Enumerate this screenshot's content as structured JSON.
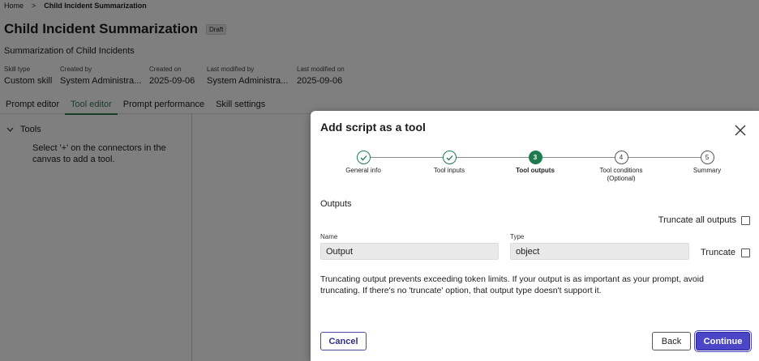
{
  "breadcrumb": {
    "home": "Home",
    "separator": ">",
    "current": "Child Incident Summarization"
  },
  "page": {
    "title": "Child Incident Summarization",
    "badge": "Draft",
    "subtitle": "Summarization of Child Incidents"
  },
  "meta": [
    {
      "key": "Skill type",
      "value": "Custom skill"
    },
    {
      "key": "Created by",
      "value": "System Administra..."
    },
    {
      "key": "Created on",
      "value": "2025-09-06"
    },
    {
      "key": "Last modified by",
      "value": "System Administra..."
    },
    {
      "key": "Last modified on",
      "value": "2025-09-06"
    }
  ],
  "tabs": [
    {
      "label": "Prompt editor",
      "active": false
    },
    {
      "label": "Tool editor",
      "active": true
    },
    {
      "label": "Prompt performance",
      "active": false
    },
    {
      "label": "Skill settings",
      "active": false
    }
  ],
  "tools": {
    "header": "Tools",
    "hint": "Select '+' on the connectors in the canvas to add a tool."
  },
  "modal": {
    "title": "Add script as a tool",
    "steps": [
      {
        "label": "General info",
        "status": "done",
        "number": "1"
      },
      {
        "label": "Tool inputs",
        "status": "done",
        "number": "2"
      },
      {
        "label": "Tool outputs",
        "status": "current",
        "number": "3"
      },
      {
        "label": "Tool conditions (Optional)",
        "status": "todo",
        "number": "4"
      },
      {
        "label": "Summary",
        "status": "todo",
        "number": "5"
      }
    ],
    "outputs_title": "Outputs",
    "truncate_all_label": "Truncate all outputs",
    "name_label": "Name",
    "name_value": "Output",
    "type_label": "Type",
    "type_value": "object",
    "truncate_label": "Truncate",
    "note": "Truncating output prevents exceeding token limits. If your output is as important as your prompt, avoid truncating. If there's no 'truncate' option, that output type doesn't support it.",
    "cancel_label": "Cancel",
    "back_label": "Back",
    "continue_label": "Continue"
  },
  "colors": {
    "accent": "#1f7a50",
    "primary_button": "#4b45c8",
    "overlay": "rgba(0,0,0,0.5)"
  }
}
